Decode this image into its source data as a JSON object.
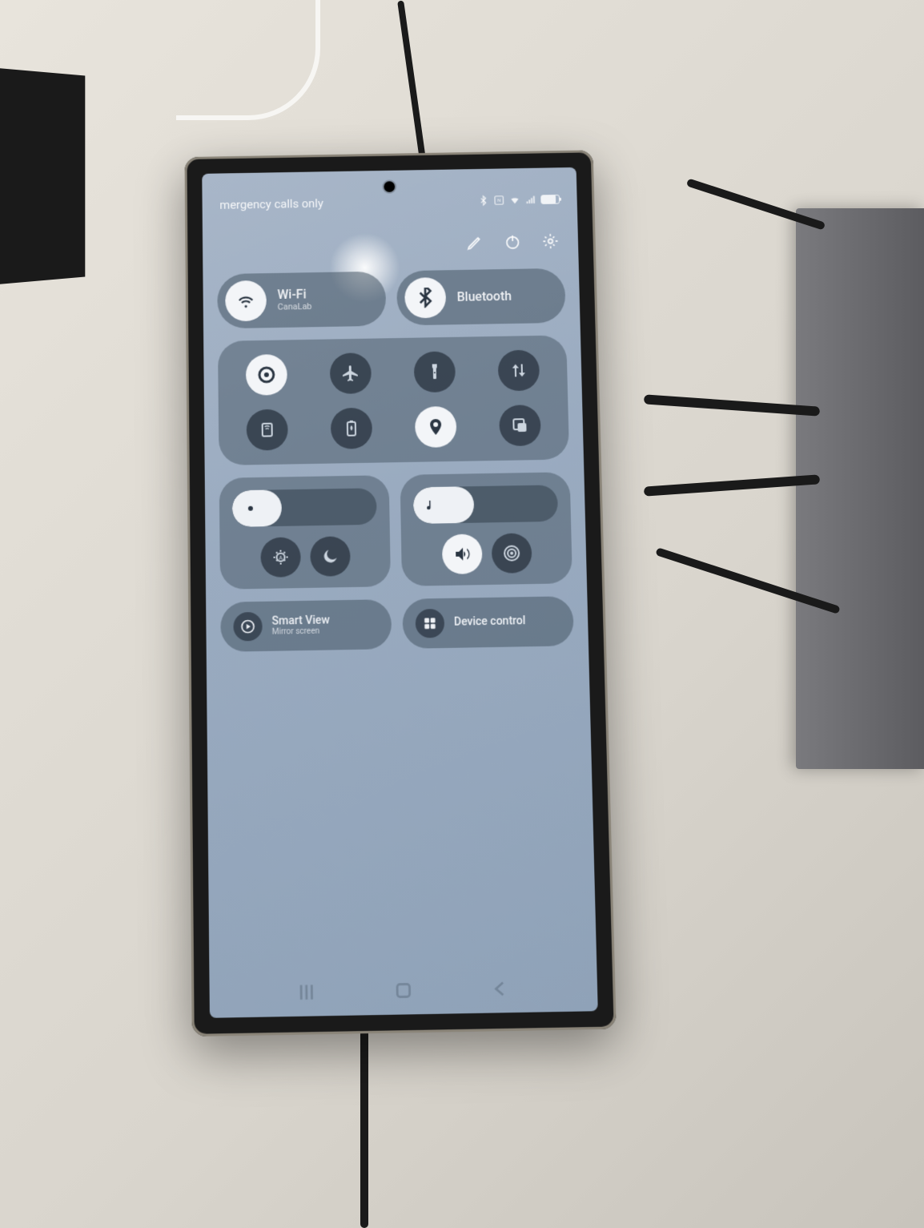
{
  "statusbar": {
    "network_text": "mergency calls only",
    "icons": [
      "bluetooth",
      "nfc",
      "wifi",
      "signal",
      "battery"
    ]
  },
  "topactions": {
    "edit": "edit",
    "power": "power",
    "settings": "settings"
  },
  "pills": {
    "wifi": {
      "label": "Wi-Fi",
      "sub": "CanaLab"
    },
    "bluetooth": {
      "label": "Bluetooth",
      "sub": ""
    }
  },
  "toggles": [
    {
      "name": "sound-mode",
      "on": true
    },
    {
      "name": "airplane-mode",
      "on": false
    },
    {
      "name": "flashlight",
      "on": false
    },
    {
      "name": "mobile-data",
      "on": false
    },
    {
      "name": "mobile-hotspot",
      "on": false
    },
    {
      "name": "power-saving",
      "on": false
    },
    {
      "name": "location",
      "on": true
    },
    {
      "name": "screen-cast",
      "on": false
    }
  ],
  "sliders": {
    "brightness": {
      "percent": 34
    },
    "volume": {
      "percent": 42
    }
  },
  "brightness_buttons": [
    {
      "name": "auto-brightness",
      "on": false
    },
    {
      "name": "dark-mode",
      "on": false
    }
  ],
  "volume_buttons": [
    {
      "name": "sound-output",
      "on": true
    },
    {
      "name": "sound-settings",
      "on": false
    }
  ],
  "capsules": {
    "smartview": {
      "label": "Smart View",
      "sub": "Mirror screen"
    },
    "devices": {
      "label": "Device control",
      "sub": ""
    }
  },
  "nav": {
    "recents": "recents",
    "home": "home",
    "back": "back"
  }
}
